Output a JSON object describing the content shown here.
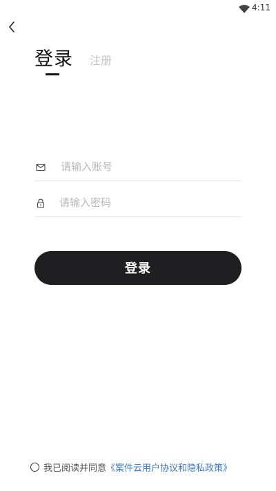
{
  "status_bar": {
    "time": "4:11",
    "wifi_icon": "wifi-icon"
  },
  "header": {
    "back_icon": "chevron-left-icon"
  },
  "tabs": {
    "login_label": "登录",
    "register_label": "注册",
    "active": "login"
  },
  "form": {
    "account": {
      "icon": "mail-icon",
      "placeholder": "请输入账号",
      "value": ""
    },
    "password": {
      "icon": "lock-icon",
      "placeholder": "请输入密码",
      "value": ""
    }
  },
  "login_button": {
    "label": "登录"
  },
  "agreement": {
    "checked": false,
    "prefix": "我已阅读并同意",
    "link": "《案件云用户协议和隐私政策》"
  },
  "colors": {
    "button_bg": "#1f1f21",
    "link": "#3b78c9",
    "placeholder": "#b8b8b8",
    "divider": "#e2e2e2"
  }
}
